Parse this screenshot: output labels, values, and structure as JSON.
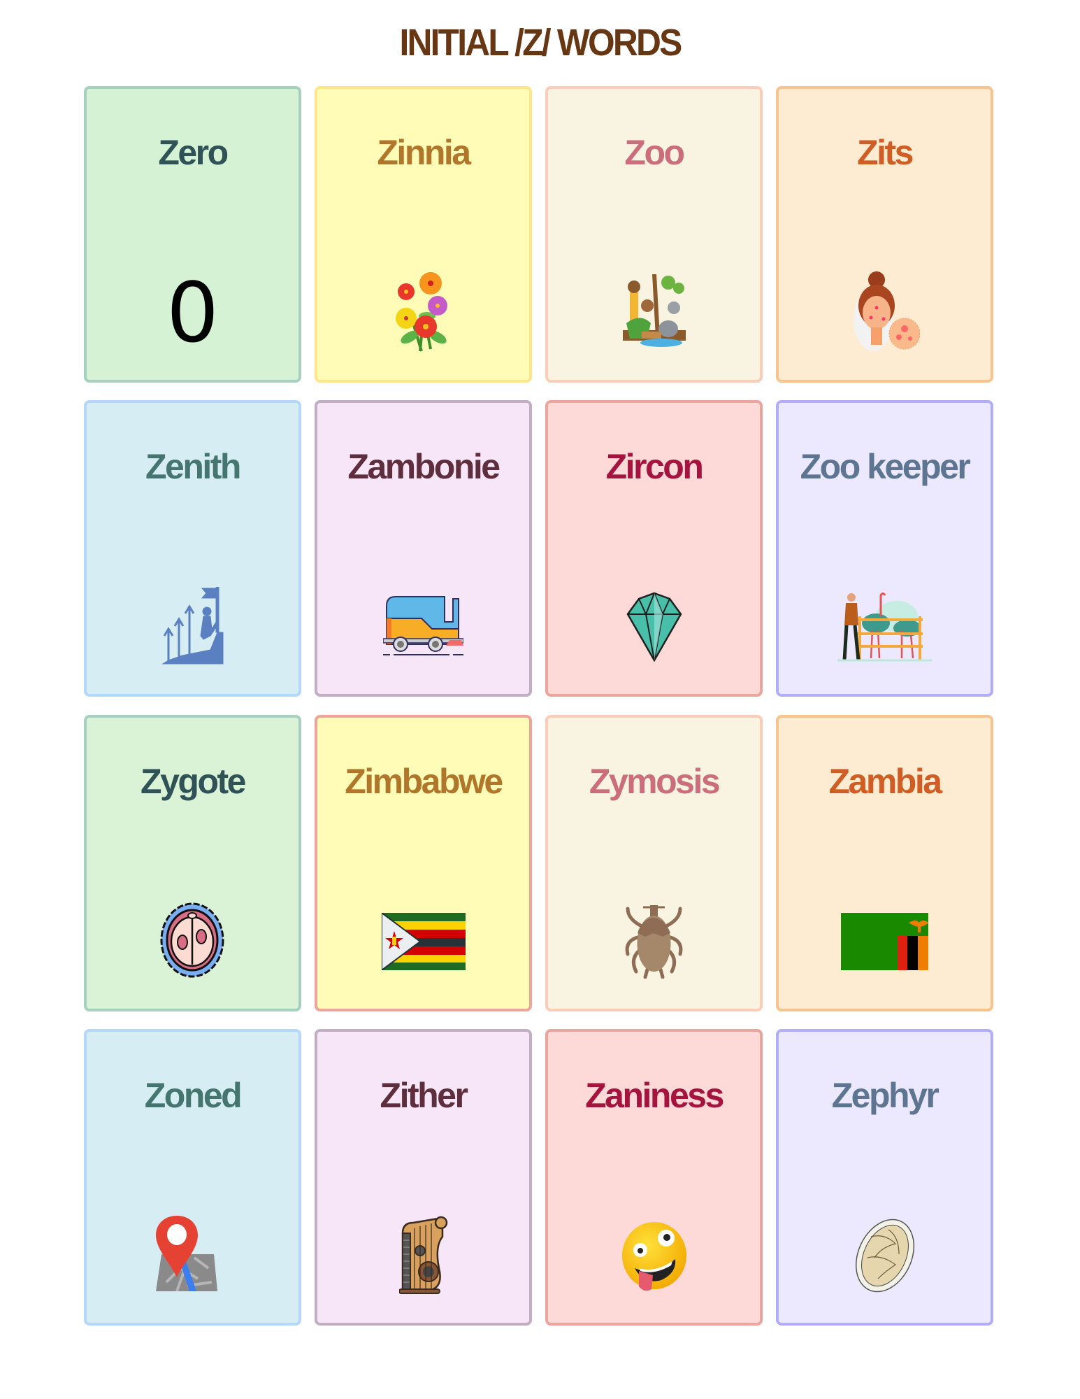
{
  "title": "INITIAL /Z/ WORDS",
  "cards": [
    {
      "word": "Zero",
      "image": "digit-zero",
      "image_text": "0",
      "bg": "#d5f3d4",
      "border": "#a7d0c0",
      "text": "#2f5257"
    },
    {
      "word": "Zinnia",
      "image": "zinnia-flowers",
      "bg": "#fffcb8",
      "border": "#ffe68a",
      "text": "#b0762a"
    },
    {
      "word": "Zoo",
      "image": "zoo-animals",
      "bg": "#f9f4e1",
      "border": "#fbcdb9",
      "text": "#cc6d7c"
    },
    {
      "word": "Zits",
      "image": "girl-with-acne",
      "bg": "#fdebd2",
      "border": "#f7c38e",
      "text": "#d05e24"
    },
    {
      "word": "Zenith",
      "image": "climber-at-peak",
      "bg": "#d6edf3",
      "border": "#b3d8fb",
      "text": "#44756f"
    },
    {
      "word": "Zambonie",
      "image": "ice-resurfacer",
      "bg": "#f6e6f7",
      "border": "#c1aec2",
      "text": "#5e2e3d"
    },
    {
      "word": "Zircon",
      "image": "gemstone",
      "bg": "#fdd9d7",
      "border": "#eba59c",
      "text": "#a5143f"
    },
    {
      "word": "Zoo keeper",
      "image": "zookeeper-with-ostriches",
      "bg": "#ece9fe",
      "border": "#b1adfb",
      "text": "#5e7591"
    },
    {
      "word": "Zygote",
      "image": "zygote-cell",
      "bg": "#daf2d6",
      "border": "#a7d0c0",
      "text": "#2f5257"
    },
    {
      "word": "Zimbabwe",
      "image": "zimbabwe-flag",
      "bg": "#fffcb8",
      "border": "#eda59a",
      "text": "#b0762a"
    },
    {
      "word": "Zymosis",
      "image": "tick-parasite",
      "bg": "#f9f4e1",
      "border": "#fbcdb9",
      "text": "#cc6d7c"
    },
    {
      "word": "Zambia",
      "image": "zambia-flag",
      "bg": "#fdebd2",
      "border": "#f7c38e",
      "text": "#d05e24"
    },
    {
      "word": "Zoned",
      "image": "map-pin",
      "bg": "#d6edf3",
      "border": "#b3d8fb",
      "text": "#44756f"
    },
    {
      "word": "Zither",
      "image": "zither-instrument",
      "bg": "#f6e6f7",
      "border": "#c1aec2",
      "text": "#5e2e3d"
    },
    {
      "word": "Zaniness",
      "image": "zany-face-emoji",
      "bg": "#fdd9d7",
      "border": "#eba59c",
      "text": "#a5143f"
    },
    {
      "word": "Zephyr",
      "image": "zephyr-pastry",
      "bg": "#ece9fe",
      "border": "#b1adfb",
      "text": "#5e7591"
    }
  ]
}
